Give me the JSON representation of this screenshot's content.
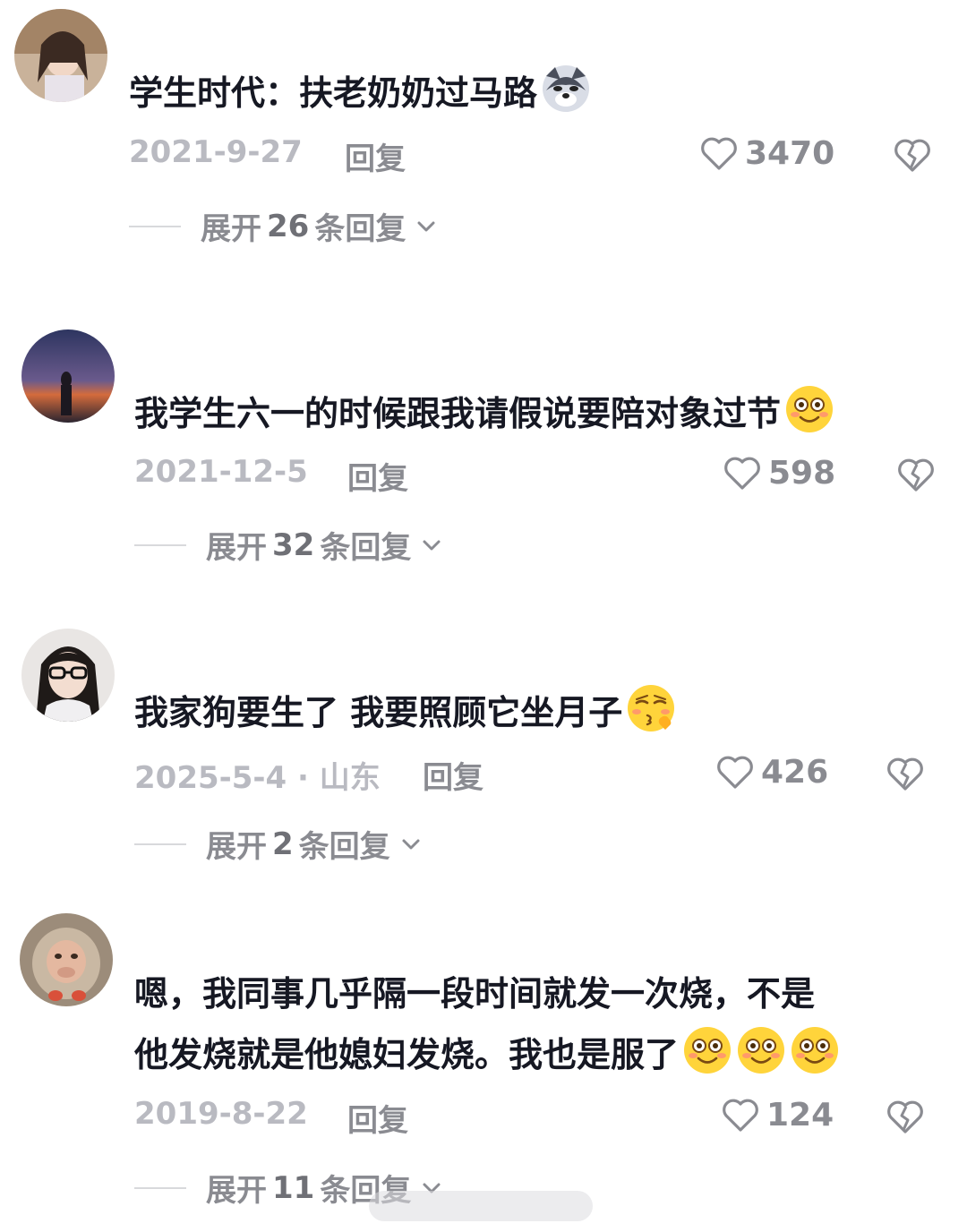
{
  "comments": [
    {
      "text": "学生时代：扶老奶奶过马路",
      "emoji_icon": "husky-emoji-icon",
      "date": "2021-9-27",
      "reply_label": "回复",
      "likes": "3470",
      "expand": {
        "prefix": "展开",
        "count": "26",
        "suffix": "条回复"
      }
    },
    {
      "text": "我学生六一的时候跟我请假说要陪对象过节",
      "emoji_icon": "smile-emoji-icon",
      "date": "2021-12-5",
      "reply_label": "回复",
      "likes": "598",
      "expand": {
        "prefix": "展开",
        "count": "32",
        "suffix": "条回复"
      }
    },
    {
      "text": "我家狗要生了 我要照顾它坐月子",
      "emoji_icon": "kiss-emoji-icon",
      "date": "2025-5-4 · 山东",
      "reply_label": "回复",
      "likes": "426",
      "expand": {
        "prefix": "展开",
        "count": "2",
        "suffix": "条回复"
      }
    },
    {
      "text_line1": "嗯，我同事几乎隔一段时间就发一次烧，不是",
      "text_line2": "他发烧就是他媳妇发烧。我也是服了",
      "emoji_icon": "smile-emoji-icon",
      "date": "2019-8-22",
      "reply_label": "回复",
      "likes": "124",
      "expand": {
        "prefix": "展开",
        "count": "11",
        "suffix": "条回复"
      }
    }
  ],
  "icons": {
    "like": "heart-outline-icon",
    "dislike": "broken-heart-icon",
    "chevron": "chevron-down-icon"
  },
  "colors": {
    "text": "#161823",
    "meta": "#b9bac1",
    "action": "#8a8b91"
  }
}
